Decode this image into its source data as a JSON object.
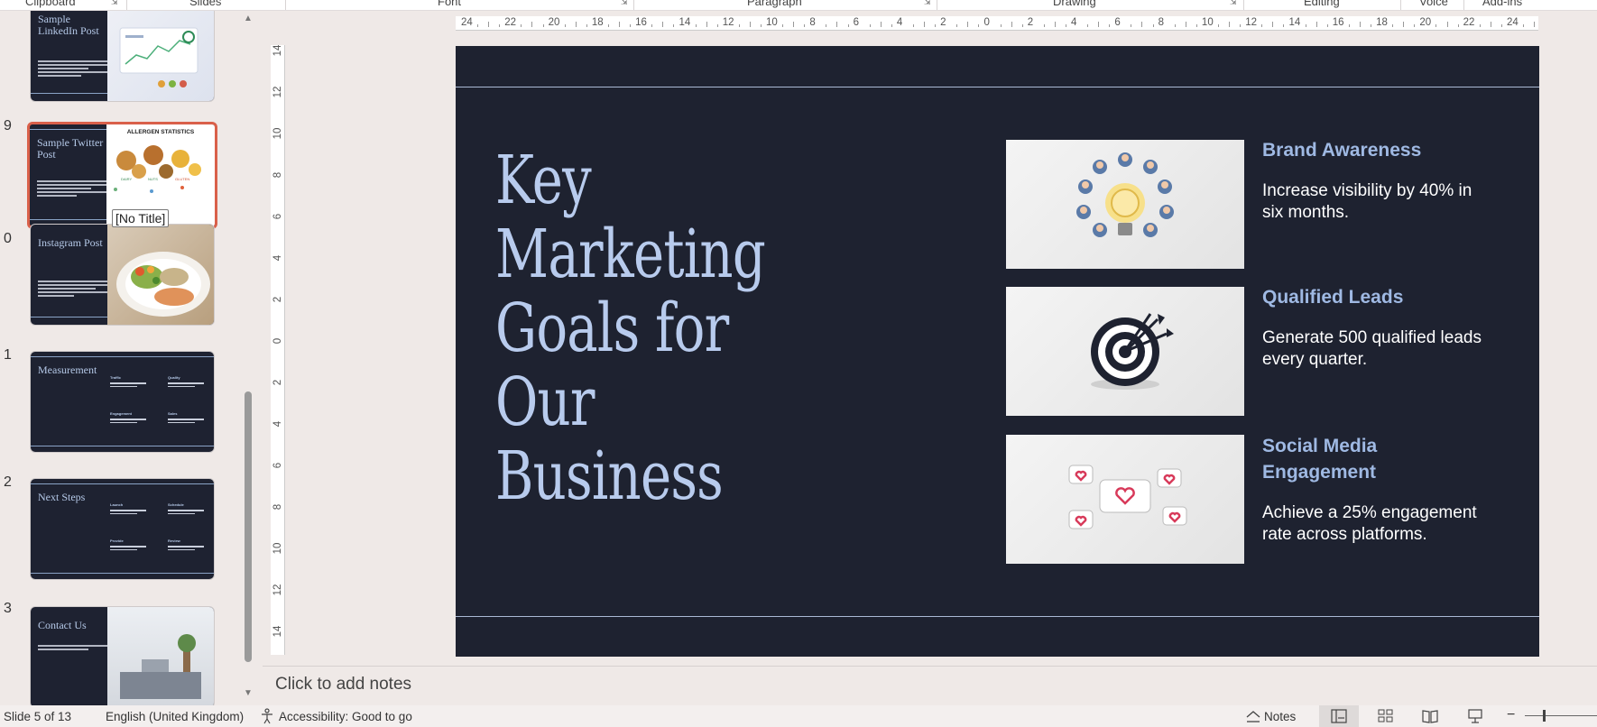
{
  "ribbon": {
    "groups": [
      "Clipboard",
      "Slides",
      "Font",
      "Paragraph",
      "Drawing",
      "Editing",
      "Voice",
      "Add-ins"
    ]
  },
  "thumbnails": [
    {
      "number": "",
      "title": "Sample LinkedIn Post",
      "selected": false
    },
    {
      "number": "9",
      "title": "Sample Twitter Post",
      "selected": true,
      "image_heading": "ALLERGEN STATISTICS"
    },
    {
      "number": "0",
      "title": "Instagram Post",
      "selected": false
    },
    {
      "number": "1",
      "title": "Measurement",
      "selected": false
    },
    {
      "number": "2",
      "title": "Next Steps",
      "selected": false
    },
    {
      "number": "3",
      "title": "Contact Us",
      "selected": false
    }
  ],
  "tooltip": "[No Title]",
  "ruler": {
    "horizontal": [
      "24",
      "22",
      "20",
      "18",
      "16",
      "14",
      "12",
      "10",
      "8",
      "6",
      "4",
      "2",
      "0",
      "2",
      "4",
      "6",
      "8",
      "10",
      "12",
      "14",
      "16",
      "18",
      "20",
      "22",
      "24"
    ],
    "vertical": [
      "14",
      "12",
      "10",
      "8",
      "6",
      "4",
      "2",
      "0",
      "2",
      "4",
      "6",
      "8",
      "10",
      "12",
      "14"
    ]
  },
  "slide": {
    "title": "Key Marketing Goals for Our Business",
    "goals": [
      {
        "heading": "Brand Awareness",
        "description": "Increase visibility by 40% in six months.",
        "icon": "lightbulb-people-icon"
      },
      {
        "heading": "Qualified Leads",
        "description": "Generate 500 qualified leads every quarter.",
        "icon": "target-arrows-icon"
      },
      {
        "heading": "Social Media Engagement",
        "description": "Achieve a 25% engagement rate across platforms.",
        "icon": "hearts-chat-icon"
      }
    ],
    "colors": {
      "background": "#1e2230",
      "title": "#b8cbed",
      "heading": "#9fb9e3",
      "text": "#ffffff"
    }
  },
  "notes": {
    "placeholder": "Click to add notes"
  },
  "status": {
    "slide_counter": "Slide 5 of 13",
    "language": "English (United Kingdom)",
    "accessibility": "Accessibility: Good to go",
    "notes_label": "Notes"
  }
}
